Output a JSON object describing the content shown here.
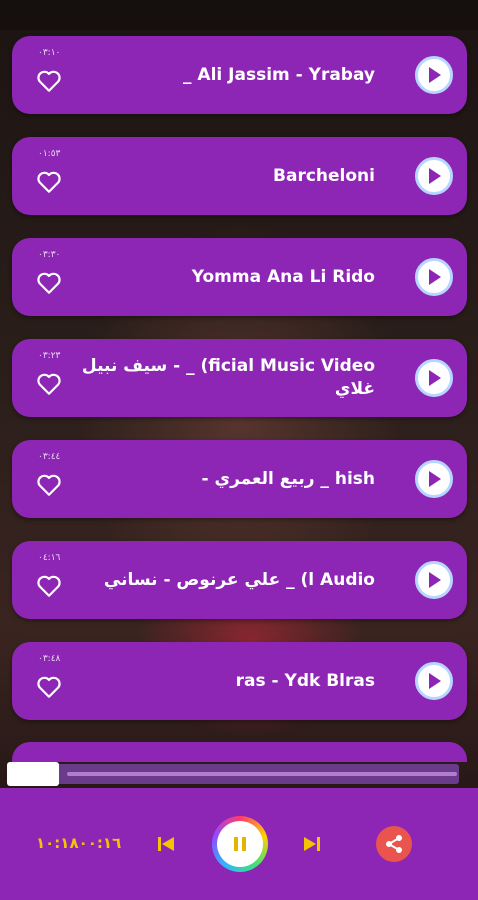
{
  "songs": [
    {
      "title": "_ Ali Jassim - Yrabay",
      "duration": "٠٣:١٠"
    },
    {
      "title": "Barcheloni",
      "duration": "٠١:٥٣"
    },
    {
      "title": "Yomma Ana Li Rido",
      "duration": "٠٣:٣٠"
    },
    {
      "title": "سيف نبيل - _ (ficial Music Video\nغلاي",
      "duration": "٠٣:٢٣"
    },
    {
      "title": "- ربيع العمري _ hish",
      "duration": "٠٣:٤٤"
    },
    {
      "title": "علي عرنوص - نساني _ (l Audio",
      "duration": "٠٤:١٦"
    },
    {
      "title": "ras - Ydk Blras",
      "duration": "٠٣:٤٨"
    }
  ],
  "player": {
    "time": "١٠:١٨٠٠:١٦",
    "progress": 0.06
  },
  "colors": {
    "card": "#8e26b5",
    "accent": "#f5c400",
    "share": "#e9544f"
  },
  "icons": {
    "play": "play-icon",
    "heart": "heart-outline-icon",
    "prev": "skip-previous-icon",
    "next": "skip-next-icon",
    "pause": "pause-icon",
    "share": "share-icon"
  }
}
